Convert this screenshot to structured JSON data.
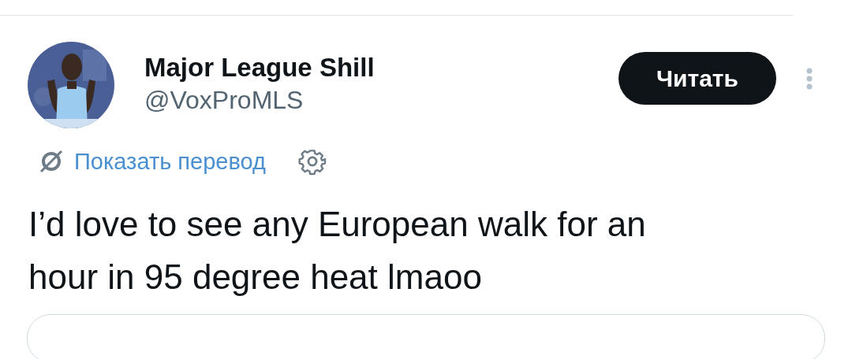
{
  "author": {
    "name": "Major League Shill",
    "handle": "@VoxProMLS"
  },
  "follow_button": {
    "label": "Читать"
  },
  "translate_link": {
    "label": "Показать перевод"
  },
  "tweet": {
    "text": "I’d love to see any European walk for an hour in 95 degree heat lmaoo"
  }
}
